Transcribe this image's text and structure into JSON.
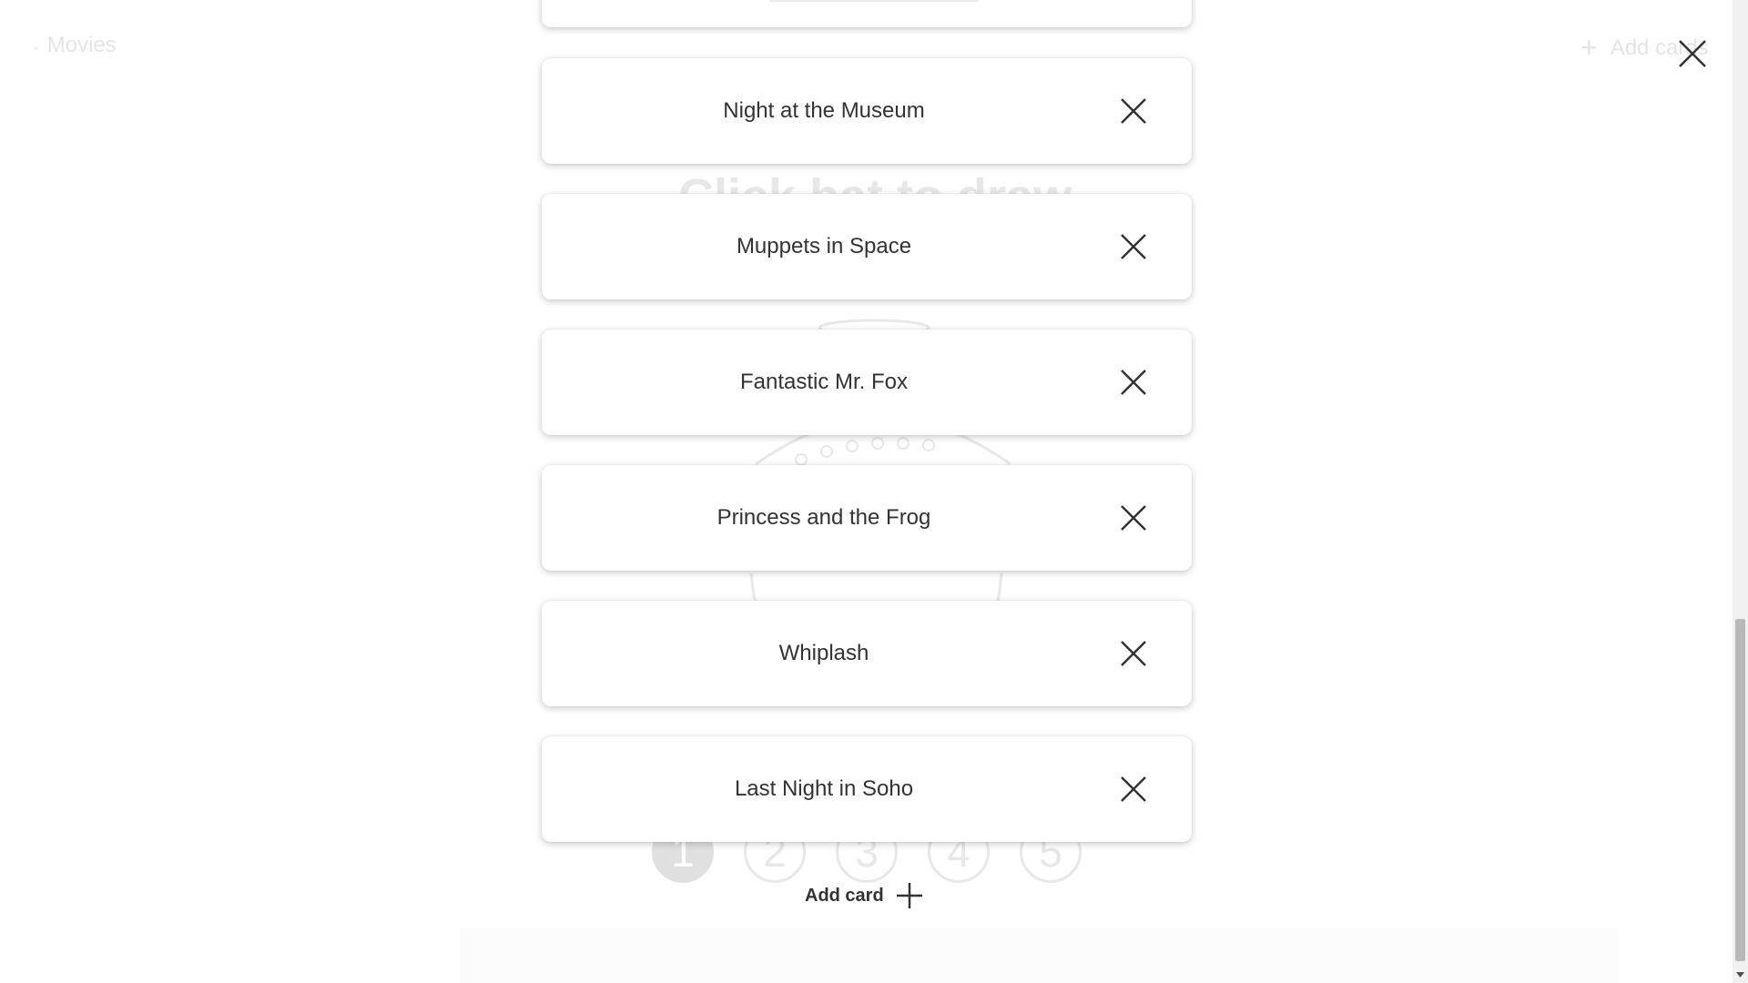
{
  "background": {
    "category_dropdown": {
      "label": "Movies"
    },
    "add_cards_label": "Add cards",
    "headline": "Click hat to draw",
    "number_selector": [
      "1",
      "2",
      "3",
      "4",
      "5"
    ]
  },
  "modal": {
    "cards": [
      {
        "title": "Night at the Museum"
      },
      {
        "title": "Muppets in Space"
      },
      {
        "title": "Fantastic Mr. Fox"
      },
      {
        "title": "Princess and the Frog"
      },
      {
        "title": "Whiplash"
      },
      {
        "title": "Last Night in Soho"
      }
    ],
    "add_card_label": "Add card"
  },
  "icons": {
    "close": "close-icon",
    "remove": "x-icon",
    "add": "plus-icon",
    "dropdown": "chevron-down-icon",
    "hat": "top-hat-illustration"
  }
}
